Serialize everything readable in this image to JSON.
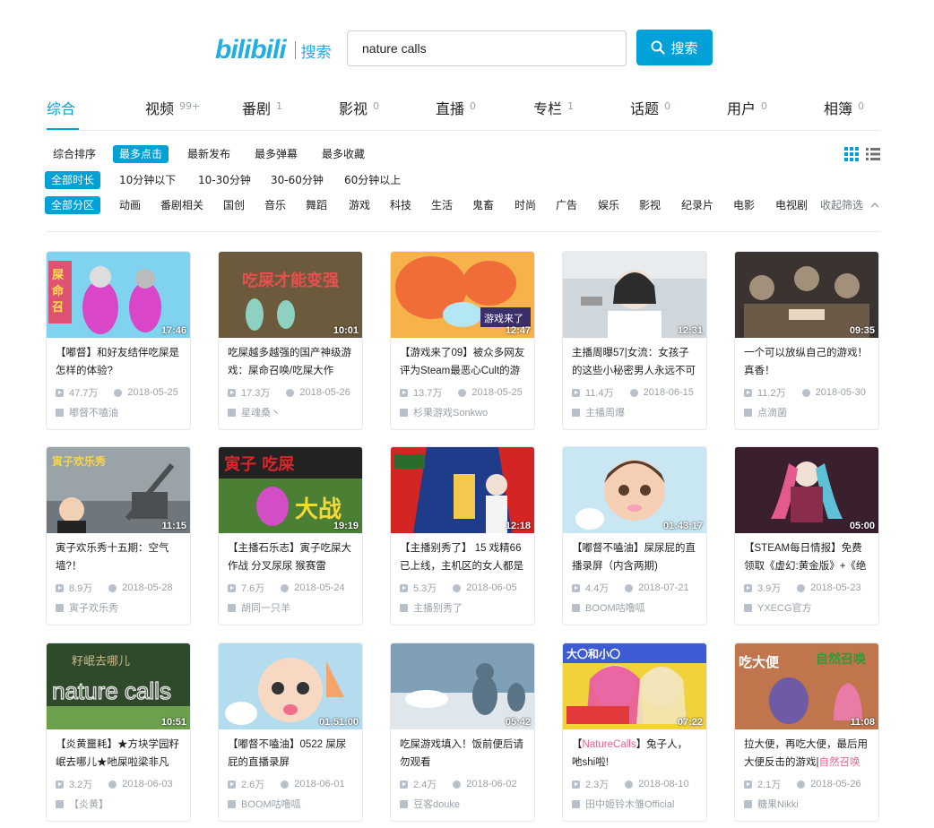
{
  "header": {
    "logo": "bilibili",
    "logo_sub": "搜索",
    "query": "nature calls",
    "search_label": "搜索"
  },
  "tabs": [
    {
      "label": "综合",
      "count": ""
    },
    {
      "label": "视频",
      "count": "99+"
    },
    {
      "label": "番剧",
      "count": "1"
    },
    {
      "label": "影视",
      "count": "0"
    },
    {
      "label": "直播",
      "count": "0"
    },
    {
      "label": "专栏",
      "count": "1"
    },
    {
      "label": "话题",
      "count": "0"
    },
    {
      "label": "用户",
      "count": "0"
    },
    {
      "label": "相簿",
      "count": "0"
    }
  ],
  "sort": [
    "综合排序",
    "最多点击",
    "最新发布",
    "最多弹幕",
    "最多收藏"
  ],
  "duration": [
    "全部时长",
    "10分钟以下",
    "10-30分钟",
    "30-60分钟",
    "60分钟以上"
  ],
  "zones": [
    "全部分区",
    "动画",
    "番剧相关",
    "国创",
    "音乐",
    "舞蹈",
    "游戏",
    "科技",
    "生活",
    "鬼畜",
    "时尚",
    "广告",
    "娱乐",
    "影视",
    "纪录片",
    "电影",
    "电视剧"
  ],
  "collapse_label": "收起筛选",
  "colors": {
    "accent": "#00a1d6",
    "highlight": "#f25d8e"
  },
  "videos": [
    {
      "dur": "17:46",
      "title": "【嘟督】和好友结伴吃屎是怎样的体验?",
      "views": "47.7万",
      "date": "2018-05-25",
      "up": "嘟督不嗑油"
    },
    {
      "dur": "10:01",
      "title": "吃屎越多越强的国产神级游戏：屎命召唤/吃屎大作",
      "views": "17.3万",
      "date": "2018-05-26",
      "up": "星魂桑丶"
    },
    {
      "dur": "12:47",
      "title": "【游戏来了09】被众多网友评为Steam最恶心Cult的游",
      "views": "13.7万",
      "date": "2018-05-25",
      "up": "杉果游戏Sonkwo"
    },
    {
      "dur": "12:31",
      "title": "主播周曝57|女流：女孩子的这些小秘密男人永远不可",
      "views": "11.4万",
      "date": "2018-06-15",
      "up": "主播周爆"
    },
    {
      "dur": "09:35",
      "title": "一个可以放纵自己的游戏！真香！",
      "views": "11.2万",
      "date": "2018-05-30",
      "up": "点滴菌"
    },
    {
      "dur": "11:15",
      "title": "寅子欢乐秀十五期：空气墙?！",
      "views": "8.9万",
      "date": "2018-05-28",
      "up": "寅子欢乐秀"
    },
    {
      "dur": "19:19",
      "title": "【主播石乐志】寅子吃屎大作战 分叉尿尿 猴赛雷",
      "views": "7.6万",
      "date": "2018-05-24",
      "up": "胡同一只羊"
    },
    {
      "dur": "12:18",
      "title": "【主播别秀了】 15 戏精66已上线，主机区的女人都是",
      "views": "5.3万",
      "date": "2018-06-05",
      "up": "主播别秀了"
    },
    {
      "dur": "01:43:17",
      "title": "【嘟督不嗑油】屎尿屁的直播录屏（内含两期)",
      "views": "4.4万",
      "date": "2018-07-21",
      "up": "BOOM咕噜呱"
    },
    {
      "dur": "05:00",
      "title": "【STEAM每日情报】免费领取《虚幻:黄金版》+《绝",
      "views": "3.9万",
      "date": "2018-05-23",
      "up": "YXECG官方"
    },
    {
      "dur": "10:51",
      "title": "【炎黄噩耗】★方块学园籽岷去哪儿★吔屎啦梁非凡",
      "views": "3.2万",
      "date": "2018-06-03",
      "up": "【炎黄】"
    },
    {
      "dur": "01:51:00",
      "title": "【嘟督不嗑油】0522 屎尿屁的直播录屏",
      "views": "2.6万",
      "date": "2018-06-01",
      "up": "BOOM咕噜呱"
    },
    {
      "dur": "05:42",
      "title": "吃屎游戏填入！饭前便后请勿观看",
      "views": "2.4万",
      "date": "2018-06-02",
      "up": "豆客douke"
    },
    {
      "dur": "07:22",
      "title_pre": "【",
      "title_hl": "NatureCalls",
      "title_post": "】兔子人，吔shi啦!",
      "views": "2.3万",
      "date": "2018-08-10",
      "up": "田中姬铃木雏Official"
    },
    {
      "dur": "11:08",
      "title_pre": "拉大便，再吃大便，最后用大便反击的游戏|",
      "title_hl": "自然召唤",
      "title_post": "",
      "views": "2.1万",
      "date": "2018-05-26",
      "up": "糖果Nikki"
    }
  ],
  "thumb_art": [
    {
      "bg": "#7fd3ef",
      "a": "#d946c8",
      "b": "#f03b5c",
      "c": "#ffe24a",
      "icon": "characters"
    },
    {
      "bg": "#3b4a2a",
      "a": "#e2a77a",
      "b": "#8fd1c1",
      "c": "#e94f4f",
      "icon": "mushroom"
    },
    {
      "bg": "#f7b24a",
      "a": "#f06d3a",
      "b": "#b2e7f3",
      "c": "#f4d7a2",
      "icon": "hands"
    },
    {
      "bg": "#cfd6dc",
      "a": "#f1e1d5",
      "b": "#2c2c2c",
      "c": "#ffffff",
      "icon": "person"
    },
    {
      "bg": "#3a3330",
      "a": "#a3907b",
      "b": "#6c5a49",
      "c": "#e8d6c1",
      "icon": "group"
    },
    {
      "bg": "#9aa3a8",
      "a": "#4b4f52",
      "b": "#f7d64a",
      "c": "#232323",
      "icon": "crane"
    },
    {
      "bg": "#4b7f34",
      "a": "#d8262b",
      "b": "#f4d838",
      "c": "#c940c7",
      "icon": "cartoon"
    },
    {
      "bg": "#1f3c8a",
      "a": "#d42424",
      "b": "#f2c94c",
      "c": "#f1e1d5",
      "icon": "stage"
    },
    {
      "bg": "#c9e6f3",
      "a": "#f6d0b4",
      "b": "#5a3c2a",
      "c": "#f4a3b8",
      "icon": "anime"
    },
    {
      "bg": "#3a1f2e",
      "a": "#e35b8c",
      "b": "#5ec0d6",
      "c": "#f1e1d5",
      "icon": "cosplay"
    },
    {
      "bg": "#2f4a2b",
      "a": "#e6e6e6",
      "b": "#6ca04d",
      "c": "#c7b78a",
      "icon": "naturecalls"
    },
    {
      "bg": "#b4dcef",
      "a": "#f7d9c3",
      "b": "#f4a36b",
      "c": "#f26d8c",
      "icon": "baby"
    },
    {
      "bg": "#7f9fb7",
      "a": "#dfe6ec",
      "b": "#5a7487",
      "c": "#ffffff",
      "icon": "snow"
    },
    {
      "bg": "#f1d23b",
      "a": "#e85a9e",
      "b": "#3e5bd6",
      "c": "#f2f2f2",
      "icon": "anime2"
    },
    {
      "bg": "#c0754d",
      "a": "#6f5aa6",
      "b": "#e97ca6",
      "c": "#2f9a3a",
      "icon": "poop"
    }
  ]
}
